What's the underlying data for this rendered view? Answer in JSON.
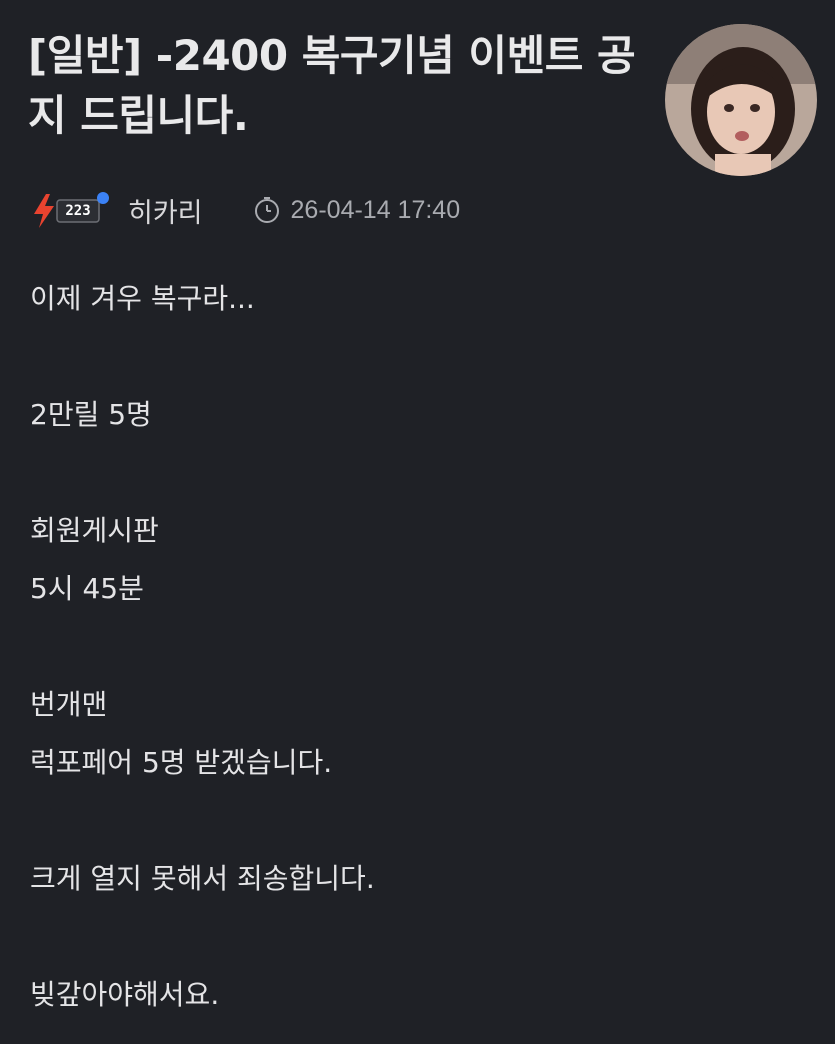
{
  "post": {
    "title": "[일반] -2400 복구기념 이벤트 공지 드립니다.",
    "author": "히카리",
    "level": "223",
    "date": "26-04-14 17:40",
    "body_paragraphs": [
      [
        "이제 겨우 복구라..."
      ],
      [
        "2만릴 5명"
      ],
      [
        "회원게시판",
        "5시 45분"
      ],
      [
        "번개맨",
        "럭포페어 5명 받겠습니다."
      ],
      [
        "크게 열지 못해서 죄송합니다."
      ],
      [
        "빚갚아야해서요."
      ]
    ]
  },
  "colors": {
    "background": "#1f2126",
    "title": "#e9e9ea",
    "body_text": "#e4e4e6",
    "meta_text": "#a9abb0",
    "level_lightning": "#e8432f",
    "online_dot": "#3b82f6"
  },
  "icons": {
    "level": "lightning-level-badge",
    "time": "clock-icon"
  }
}
